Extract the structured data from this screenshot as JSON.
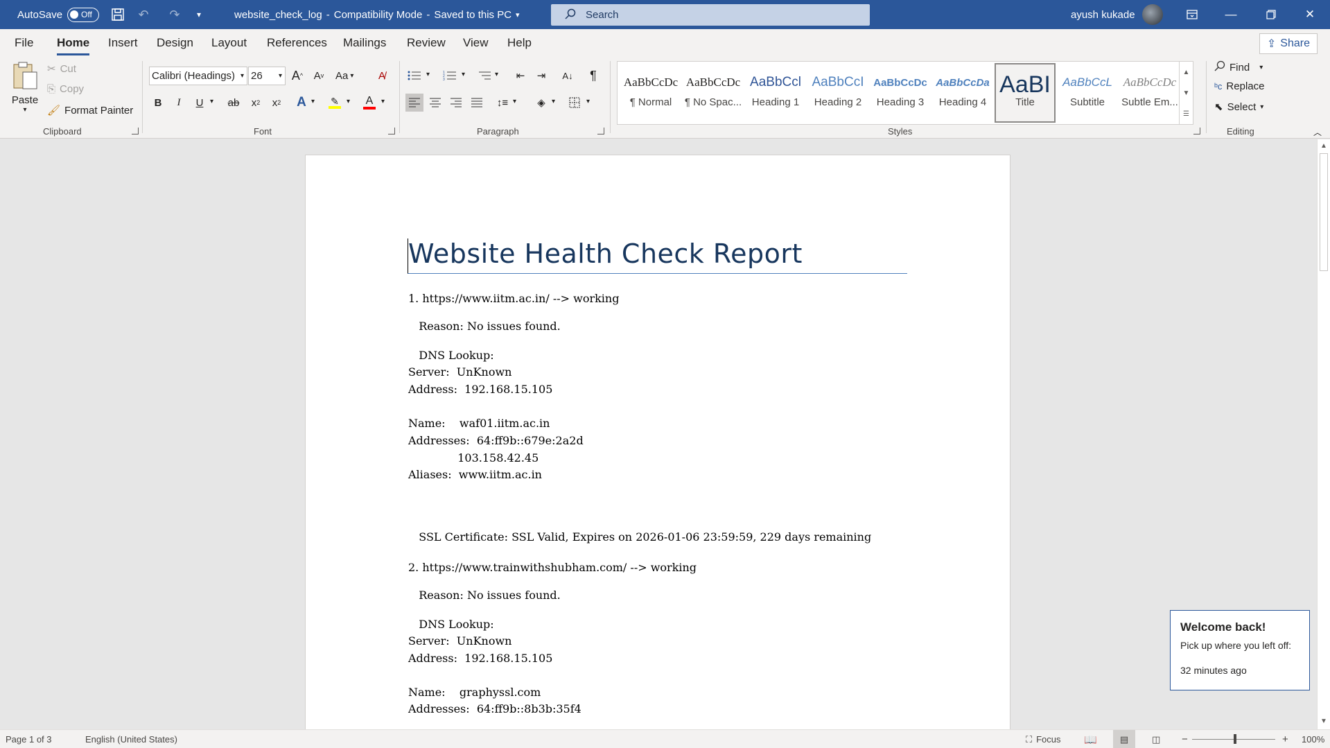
{
  "titlebar": {
    "autosave_label": "AutoSave",
    "autosave_state": "Off",
    "doc_name": "website_check_log",
    "doc_sep1": "-",
    "doc_mode": "Compatibility Mode",
    "doc_sep2": "-",
    "doc_status": "Saved to this PC",
    "search_placeholder": "Search",
    "user_name": "ayush kukade"
  },
  "tabs": [
    "File",
    "Home",
    "Insert",
    "Design",
    "Layout",
    "References",
    "Mailings",
    "Review",
    "View",
    "Help"
  ],
  "share_label": "Share",
  "clipboard": {
    "paste": "Paste",
    "cut": "Cut",
    "copy": "Copy",
    "format_painter": "Format Painter",
    "group": "Clipboard"
  },
  "font": {
    "name": "Calibri (Headings)",
    "size": "26",
    "group": "Font",
    "case_label": "Aa",
    "grow": "A",
    "shrink": "A",
    "bold": "B",
    "italic": "I",
    "underline": "U",
    "strike": "ab",
    "subscript": "x",
    "superscript": "x",
    "highlight_color": "#ffff00",
    "font_color": "#ff0000"
  },
  "paragraph": {
    "group": "Paragraph"
  },
  "styles": {
    "group": "Styles",
    "items": [
      {
        "sample": "AaBbCcDc",
        "name": "¶ Normal"
      },
      {
        "sample": "AaBbCcDc",
        "name": "¶ No Spac..."
      },
      {
        "sample": "AaBbCcl",
        "name": "Heading 1"
      },
      {
        "sample": "AaBbCcI",
        "name": "Heading 2"
      },
      {
        "sample": "AaBbCcDc",
        "name": "Heading 3"
      },
      {
        "sample": "AaBbCcDa",
        "name": "Heading 4"
      },
      {
        "sample": "AaBI",
        "name": "Title"
      },
      {
        "sample": "AaBbCcL",
        "name": "Subtitle"
      },
      {
        "sample": "AaBbCcDc",
        "name": "Subtle Em..."
      }
    ]
  },
  "editing": {
    "find": "Find",
    "replace": "Replace",
    "select": "Select",
    "group": "Editing"
  },
  "document": {
    "title": "Website Health Check Report",
    "lines": [
      "1. https://www.iitm.ac.in/ --> working",
      "   Reason: No issues found.",
      "   DNS Lookup:",
      "Server:  UnKnown",
      "Address:  192.168.15.105",
      "Name:    waf01.iitm.ac.in",
      "Addresses:  64:ff9b::679e:2a2d",
      "              103.158.42.45",
      "Aliases:  www.iitm.ac.in",
      "   SSL Certificate: SSL Valid, Expires on 2026-01-06 23:59:59, 229 days remaining",
      "2. https://www.trainwithshubham.com/ --> working",
      "   Reason: No issues found.",
      "   DNS Lookup:",
      "Server:  UnKnown",
      "Address:  192.168.15.105",
      "Name:    graphyssl.com",
      "Addresses:  64:ff9b::8b3b:35f4"
    ]
  },
  "toast": {
    "title": "Welcome back!",
    "message": "Pick up where you left off:",
    "time": "32 minutes ago"
  },
  "status": {
    "page": "Page 1 of 3",
    "language": "English (United States)",
    "focus": "Focus",
    "zoom": "100%",
    "zoom_level_percent": 100
  }
}
